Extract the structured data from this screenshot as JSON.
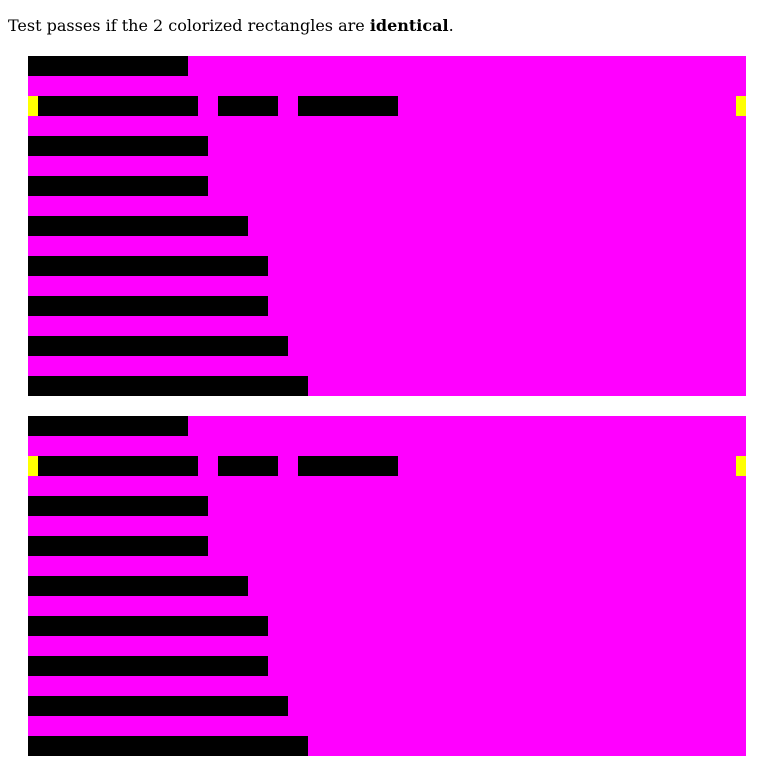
{
  "instruction": {
    "prefix": "Test passes if the 2 colorized rectangles are ",
    "emphasis": "identical",
    "suffix": "."
  },
  "colors": {
    "background": "#ff00ff",
    "bar": "#000000",
    "marker": "#ffff00",
    "text": "#000000"
  },
  "rectangle_count": 2
}
